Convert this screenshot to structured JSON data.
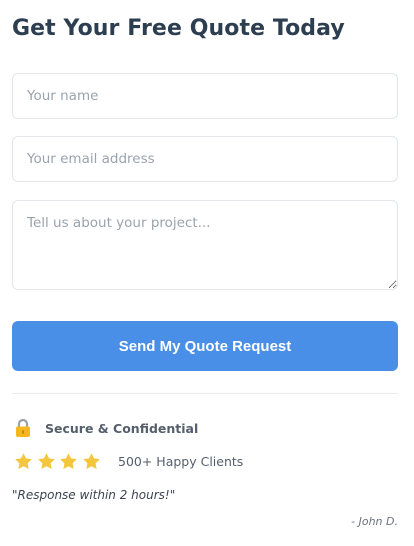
{
  "form": {
    "title": "Get Your Free Quote Today",
    "name_placeholder": "Your name",
    "email_placeholder": "Your email address",
    "message_placeholder": "Tell us about your project...",
    "submit_label": "Send My Quote Request"
  },
  "trust": {
    "secure_label": "Secure & Confidential",
    "lock_icon": "lock-icon",
    "rating_stars": 4,
    "star_color": "#f4c63d",
    "clients_label": "500+ Happy Clients",
    "testimonial": "\"Response within 2 hours!\"",
    "author": "- John D."
  },
  "colors": {
    "accent": "#4a8fe7",
    "title": "#2c3e50"
  }
}
